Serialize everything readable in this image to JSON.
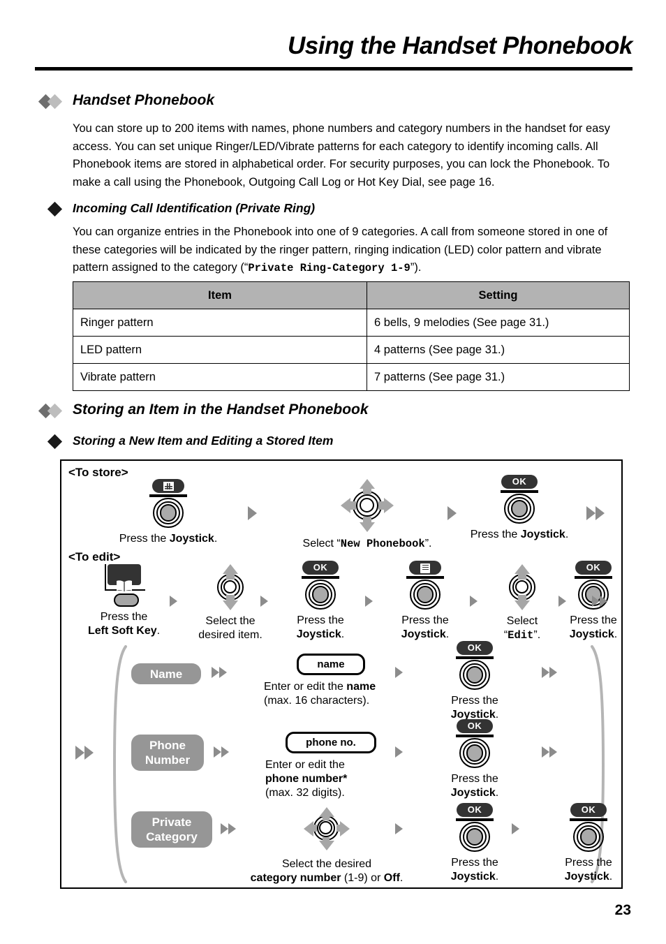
{
  "header": {
    "title": "Using the Handset Phonebook",
    "page_number": "23"
  },
  "sections": {
    "handset_phonebook": {
      "heading": "Handset Phonebook",
      "body": "You can store up to 200 items with names, phone numbers and category numbers in the handset for easy access. You can set unique Ringer/LED/Vibrate patterns for each category to identify incoming calls. All Phonebook items are stored in alphabetical order. For security purposes, you can lock the Phonebook. To make a call using the Phonebook, Outgoing Call Log or Hot Key Dial, see page 16."
    },
    "incoming_call": {
      "heading": "Incoming Call Identification (Private Ring)",
      "body_part1": "You can organize entries in the Phonebook into one of 9 categories. A call from someone stored in one of these categories will be indicated by the ringer pattern, ringing indication (LED) color pattern and vibrate pattern assigned to the category (“",
      "body_mono": "Private Ring-Category 1-9",
      "body_part2": "”)."
    },
    "storing_item": {
      "heading": "Storing an Item in the Handset Phonebook"
    },
    "storing_new": {
      "heading": "Storing a New Item and Editing a Stored Item"
    }
  },
  "table": {
    "headers": [
      "Item",
      "Setting"
    ],
    "rows": [
      [
        "Ringer pattern",
        "6 bells, 9 melodies (See page 31.)"
      ],
      [
        "LED pattern",
        "4 patterns (See page 31.)"
      ],
      [
        "Vibrate pattern",
        "7 patterns (See page 31.)"
      ]
    ]
  },
  "flow": {
    "to_store_label": "<To store>",
    "to_edit_label": "<To edit>",
    "store_steps": [
      {
        "key": "MENU",
        "caption_pre": "Press the ",
        "caption_bold": "Joystick",
        "caption_post": "."
      },
      {
        "caption_pre": "Select “",
        "caption_mono": "New Phonebook",
        "caption_post": "”."
      },
      {
        "key": "OK",
        "caption_pre": "Press the ",
        "caption_bold": "Joystick",
        "caption_post": "."
      }
    ],
    "edit_steps": [
      {
        "caption_l1": "Press the",
        "caption_l2": "Left Soft Key",
        "caption_l2_post": "."
      },
      {
        "caption_l1": "Select the",
        "caption_l2_plain": "desired item."
      },
      {
        "key": "OK",
        "caption_l1": "Press the",
        "caption_l2": "Joystick",
        "caption_l2_post": "."
      },
      {
        "key": "LIST",
        "caption_l1": "Press the",
        "caption_l2": "Joystick",
        "caption_l2_post": "."
      },
      {
        "caption_l1": "Select",
        "caption_l2_quote_open": "“",
        "caption_l2_mono": "Edit",
        "caption_l2_quote_close": "”."
      },
      {
        "key": "OK",
        "caption_l1": "Press the",
        "caption_l2": "Joystick",
        "caption_l2_post": "."
      }
    ],
    "branches": [
      {
        "pill": "Name",
        "bubble": "name",
        "desc_pre": "Enter or edit the ",
        "desc_bold": "name",
        "desc_line2": "(max. 16 characters).",
        "ok_key": "OK",
        "ok_l1": "Press the",
        "ok_l2": "Joystick",
        "ok_l2_post": "."
      },
      {
        "pill_line1": "Phone",
        "pill_line2": "Number",
        "bubble": "phone no.",
        "desc_pre": "Enter or edit the",
        "desc_bold": "phone number*",
        "desc_line2": "(max. 32 digits).",
        "ok_key": "OK",
        "ok_l1": "Press the",
        "ok_l2": "Joystick",
        "ok_l2_post": "."
      },
      {
        "pill_line1": "Private",
        "pill_line2": "Category",
        "desc_pre": "Select the desired",
        "desc_bold": "category number",
        "desc_mid": " (1-9) or ",
        "desc_bold2": "Off",
        "desc_post": ".",
        "ok_key": "OK",
        "ok_l1": "Press the",
        "ok_l2": "Joystick",
        "ok_l2_post": ".",
        "ok_key2": "OK",
        "ok2_l1": "Press the",
        "ok2_l2": "Joystick",
        "ok2_l2_post": "."
      }
    ]
  },
  "colors": {
    "table_header_bg": "#b3b3b3",
    "gray_pill": "#969696",
    "arrow_gray": "#8c8c8c",
    "key_dark": "#333333",
    "joystick_center": "#aaaaaa",
    "diamond_dark": "#6e6e6e",
    "diamond_light": "#bdbdbd"
  }
}
